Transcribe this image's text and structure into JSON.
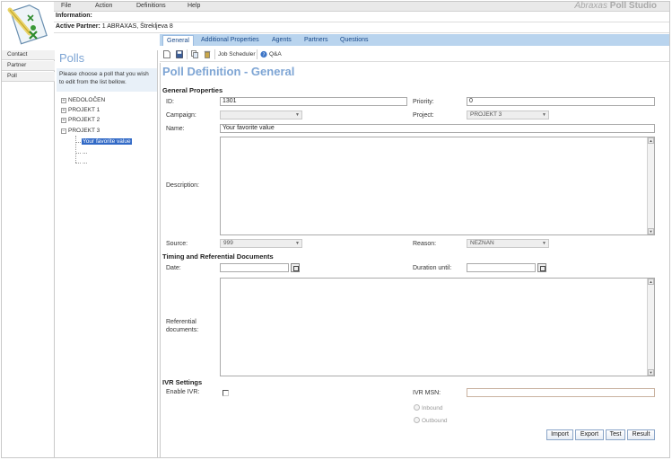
{
  "app": {
    "brand_italic": "Abraxas",
    "brand_bold": "Poll Studio"
  },
  "menu": [
    "File",
    "Action",
    "Definitions",
    "Help"
  ],
  "info": {
    "label": "Information:",
    "partner_label": "Active Partner:",
    "partner_value": "1 ABRAXAS, Štrekljeva 8"
  },
  "tabs": [
    {
      "label": "General",
      "active": true
    },
    {
      "label": "Additional Properties",
      "active": false
    },
    {
      "label": "Agents",
      "active": false
    },
    {
      "label": "Partners",
      "active": false
    },
    {
      "label": "Questions",
      "active": false
    }
  ],
  "nav": [
    "Contact",
    "Partner",
    "Poll"
  ],
  "polls": {
    "title": "Polls",
    "hint": "Please choose a poll that you wish to edit from the list bellow.",
    "tree": [
      {
        "label": "NEDOLOČEN",
        "toggle": "+"
      },
      {
        "label": "PROJEKT 1",
        "toggle": "+"
      },
      {
        "label": "PROJEKT 2",
        "toggle": "+"
      },
      {
        "label": "PROJEKT 3",
        "toggle": "−"
      }
    ],
    "children": [
      "Your favorite value",
      "...",
      "..."
    ]
  },
  "toolbar": {
    "job_scheduler": "Job Scheduler",
    "qa": "Q&A"
  },
  "form": {
    "title": "Poll Definition - General",
    "general_section": "General Properties",
    "id_label": "ID:",
    "id_value": "1301",
    "priority_label": "Priority:",
    "priority_value": "0",
    "campaign_label": "Campaign:",
    "campaign_value": "",
    "project_label": "Project:",
    "project_value": "PROJEKT 3",
    "name_label": "Name:",
    "name_value": "Your favorite value",
    "description_label": "Description:",
    "source_label": "Source:",
    "source_value": "999",
    "reason_label": "Reason:",
    "reason_value": "NEZNAN",
    "timing_section": "Timing and Referential Documents",
    "date_label": "Date:",
    "duration_label": "Duration until:",
    "refdocs_label_1": "Referential",
    "refdocs_label_2": "documents:",
    "ivr_section": "IVR Settings",
    "enable_ivr_label": "Enable IVR:",
    "ivr_msn_label": "IVR MSN:",
    "inbound_label": "Inbound",
    "outbound_label": "Outbound"
  },
  "buttons": {
    "import": "Import",
    "export": "Export",
    "test": "Test",
    "result": "Result"
  }
}
